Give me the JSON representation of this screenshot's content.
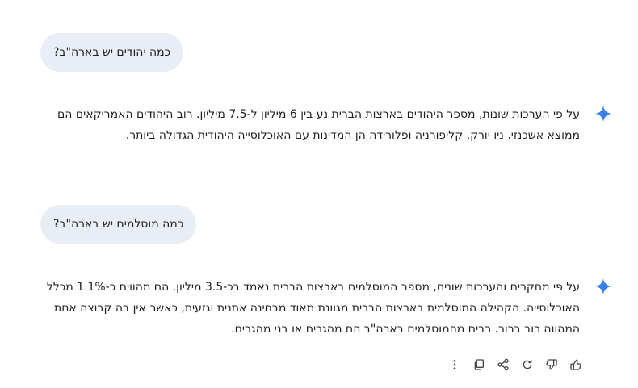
{
  "conversation": [
    {
      "question": "כמה יהודים יש בארה\"ב?",
      "answer": "על פי הערכות שונות, מספר היהודים בארצות הברית נע בין 6 מיליון ל-7.5 מיליון. רוב היהודים האמריקאים הם ממוצא אשכנזי. ניו יורק, קליפורניה ופלורידה הן המדינות עם האוכלוסייה היהודית הגדולה ביותר."
    },
    {
      "question": "כמה מוסלמים יש בארה\"ב?",
      "answer": "על פי מחקרים והערכות שונים, מספר המוסלמים בארצות הברית נאמד בכ-3.5 מיליון. הם מהווים כ-1.1% מכלל האוכלוסייה. הקהילה המוסלמית בארצות הברית מגוונת מאוד מבחינה אתנית וגזעית, כאשר אין בה קבוצה אחת המהווה רוב ברור. רבים מהמוסלמים בארה\"ב הם מהגרים או בני מהגרים."
    }
  ],
  "response_actions": [
    "thumbs-up-icon",
    "thumbs-down-icon",
    "regenerate-icon",
    "share-icon",
    "copy-icon",
    "more-vert-icon"
  ],
  "colors": {
    "bubble_bg": "#e9eef6",
    "spark_start": "#4285f4",
    "spark_end": "#1a73e8",
    "icon": "#444746",
    "text": "#1f1f1f"
  }
}
